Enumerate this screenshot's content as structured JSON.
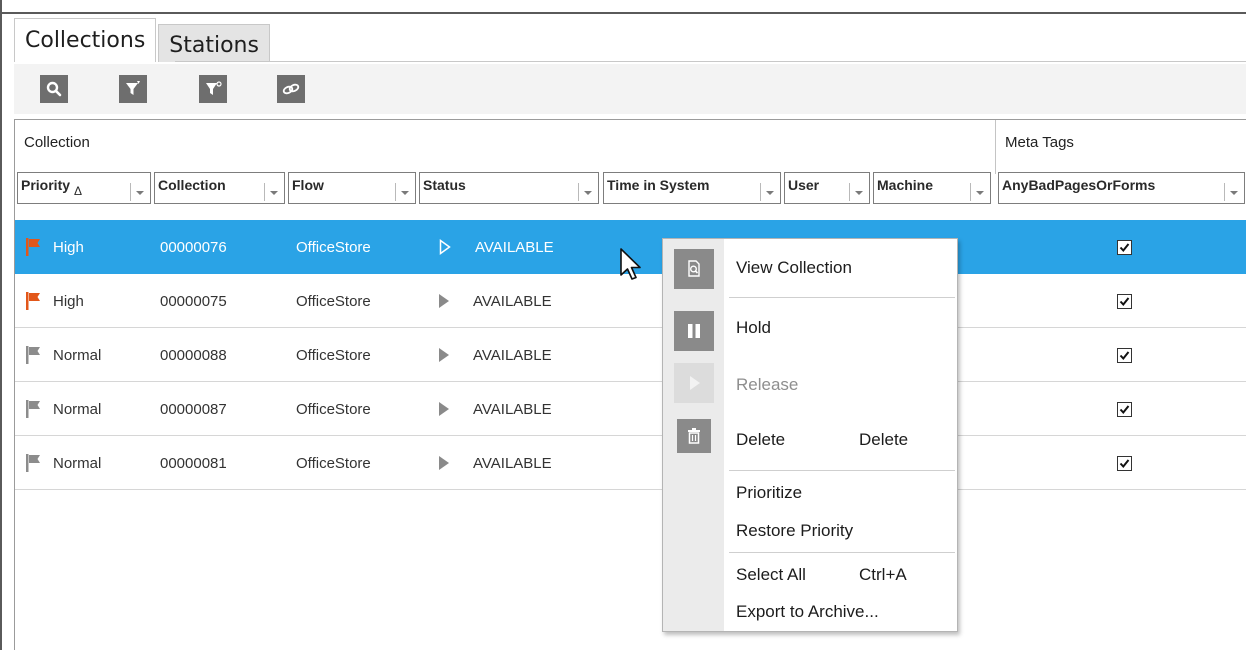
{
  "tabs": [
    {
      "label": "Collections",
      "active": true
    },
    {
      "label": "Stations",
      "active": false
    }
  ],
  "toolbar": {
    "buttons": [
      "search-icon",
      "filter-icon",
      "filter-settings-icon",
      "link-icon"
    ]
  },
  "grid": {
    "group_headers": {
      "collection": "Collection",
      "meta_tags": "Meta Tags"
    },
    "columns": [
      "Priority",
      "Collection",
      "Flow",
      "Status",
      "Time in System",
      "User",
      "Machine",
      "AnyBadPagesOrForms"
    ],
    "sort_indicator": "Δ",
    "rows": [
      {
        "priority": "High",
        "collection": "00000076",
        "flow": "OfficeStore",
        "status": "AVAILABLE",
        "any_bad": true,
        "selected": true
      },
      {
        "priority": "High",
        "collection": "00000075",
        "flow": "OfficeStore",
        "status": "AVAILABLE",
        "any_bad": true,
        "selected": false
      },
      {
        "priority": "Normal",
        "collection": "00000088",
        "flow": "OfficeStore",
        "status": "AVAILABLE",
        "any_bad": true,
        "selected": false
      },
      {
        "priority": "Normal",
        "collection": "00000087",
        "flow": "OfficeStore",
        "status": "AVAILABLE",
        "any_bad": true,
        "selected": false
      },
      {
        "priority": "Normal",
        "collection": "00000081",
        "flow": "OfficeStore",
        "status": "AVAILABLE",
        "any_bad": true,
        "selected": false
      }
    ]
  },
  "context_menu": {
    "view": "View Collection",
    "hold": "Hold",
    "release": "Release",
    "delete": "Delete",
    "delete_shortcut": "Delete",
    "prioritize": "Prioritize",
    "restore_priority": "Restore Priority",
    "select_all": "Select All",
    "select_all_shortcut": "Ctrl+A",
    "export": "Export to Archive..."
  },
  "colors": {
    "selection": "#2aa3e6",
    "high_flag": "#e2571a",
    "normal_flag": "#8c8c8c",
    "icon_gray": "#6e6e6e"
  }
}
